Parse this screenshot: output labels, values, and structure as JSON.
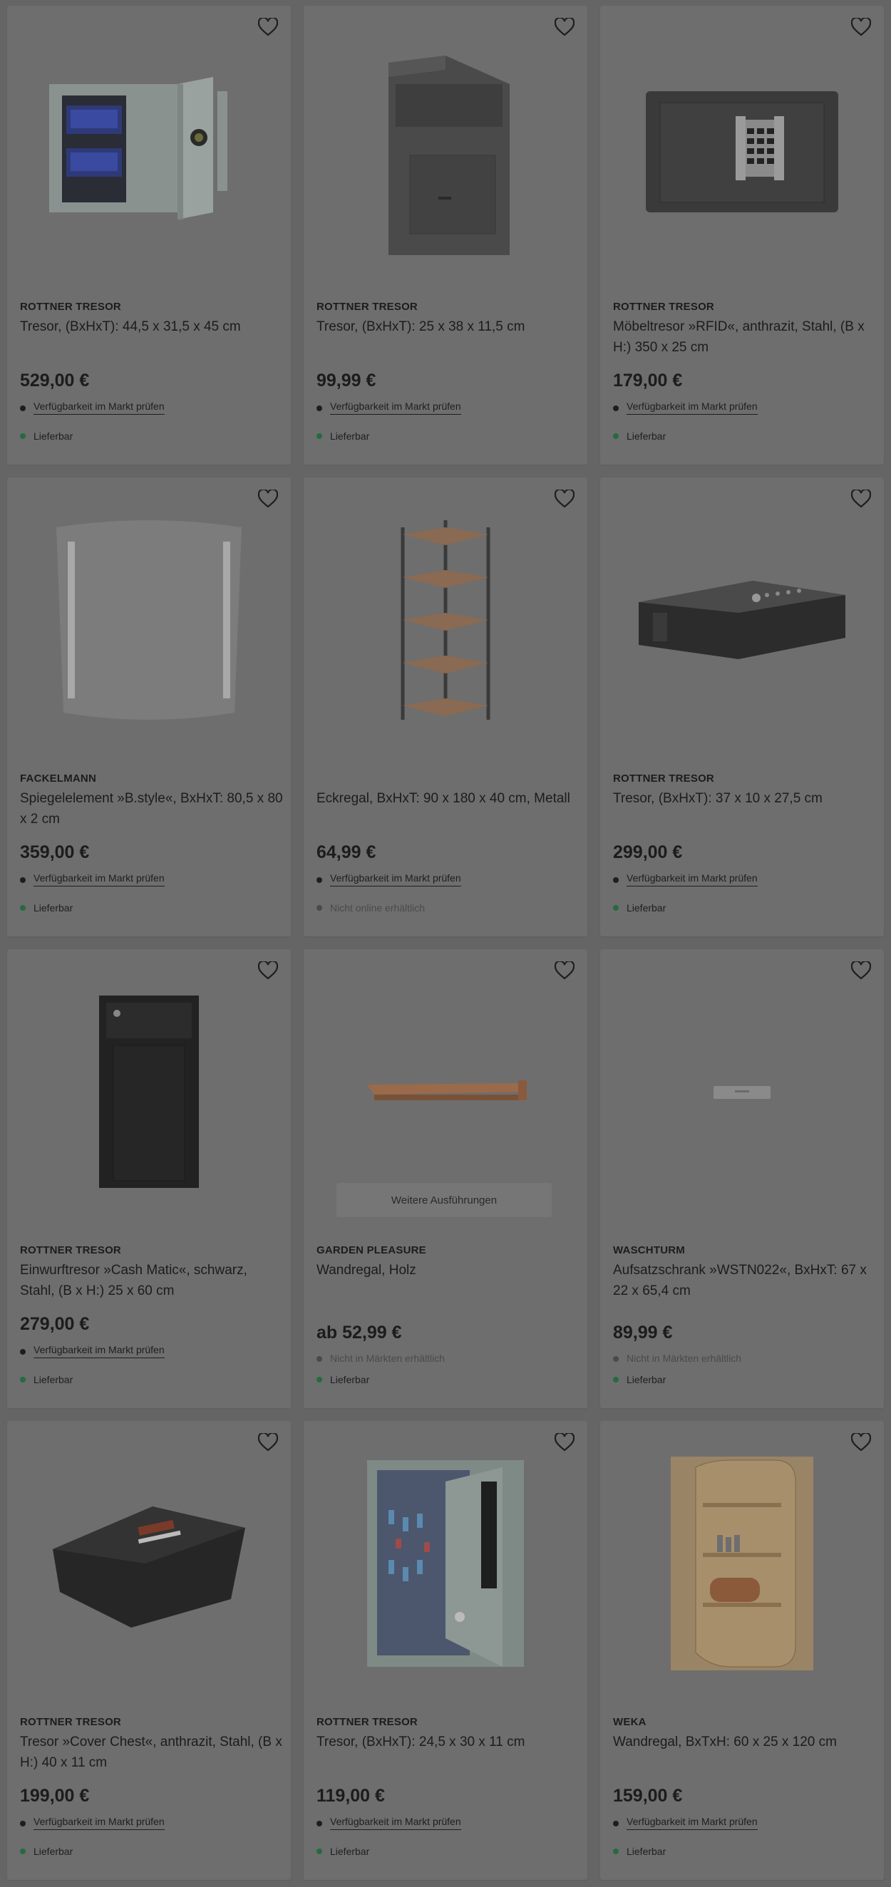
{
  "products": [
    {
      "brand": "ROTTNER TRESOR",
      "title": "Tresor, (BxHxT): 44,5 x 31,5 x 45 cm",
      "price": "529,00 €",
      "market": "Verfügbarkeit im Markt prüfen",
      "delivery": "Lieferbar",
      "image": "safe-open-icon"
    },
    {
      "brand": "ROTTNER TRESOR",
      "title": "Tresor, (BxHxT): 25 x 38 x 11,5 cm",
      "price": "99,99 €",
      "market": "Verfügbarkeit im Markt prüfen",
      "delivery": "Lieferbar",
      "image": "deposit-box-icon"
    },
    {
      "brand": "ROTTNER TRESOR",
      "title": "Möbeltresor »RFID«, anthrazit, Stahl, (B x H:) 350 x 25 cm",
      "price": "179,00 €",
      "market": "Verfügbarkeit im Markt prüfen",
      "delivery": "Lieferbar",
      "image": "electronic-safe-icon"
    },
    {
      "brand": "FACKELMANN",
      "title": "Spiegelelement »B.style«, BxHxT: 80,5 x 80 x 2 cm",
      "price": "359,00 €",
      "market": "Verfügbarkeit im Markt prüfen",
      "delivery": "Lieferbar",
      "image": "mirror-icon"
    },
    {
      "brand": "",
      "title": "Eckregal, BxHxT: 90 x 180 x 40 cm, Metall",
      "price": "64,99 €",
      "market": "Verfügbarkeit im Markt prüfen",
      "delivery": "Nicht online erhältlich",
      "image": "corner-shelf-icon"
    },
    {
      "brand": "ROTTNER TRESOR",
      "title": "Tresor, (BxHxT): 37 x 10 x 27,5 cm",
      "price": "299,00 €",
      "market": "Verfügbarkeit im Markt prüfen",
      "delivery": "Lieferbar",
      "image": "flat-safe-icon"
    },
    {
      "brand": "ROTTNER TRESOR",
      "title": "Einwurftresor »Cash Matic«, schwarz, Stahl, (B x H:) 25 x 60 cm",
      "price": "279,00 €",
      "market": "Verfügbarkeit im Markt prüfen",
      "delivery": "Lieferbar",
      "image": "cash-safe-icon"
    },
    {
      "brand": "GARDEN PLEASURE",
      "title": "Wandregal, Holz",
      "price": "ab 52,99 €",
      "market": "Nicht in Märkten erhältlich",
      "delivery": "Lieferbar",
      "image": "wall-shelf-icon",
      "variants": "Weitere Ausführungen"
    },
    {
      "brand": "WASCHTURM",
      "title": "Aufsatzschrank »WSTN022«, BxHxT: 67 x 22 x 65,4 cm",
      "price": "89,99 €",
      "market": "Nicht in Märkten erhältlich",
      "delivery": "Lieferbar",
      "image": "small-cabinet-icon"
    },
    {
      "brand": "ROTTNER TRESOR",
      "title": "Tresor »Cover Chest«, anthrazit, Stahl, (B x H:) 40 x 11 cm",
      "price": "199,00 €",
      "market": "Verfügbarkeit im Markt prüfen",
      "delivery": "Lieferbar",
      "image": "cover-chest-icon"
    },
    {
      "brand": "ROTTNER TRESOR",
      "title": "Tresor, (BxHxT): 24,5 x 30 x 11 cm",
      "price": "119,00 €",
      "market": "Verfügbarkeit im Markt prüfen",
      "delivery": "Lieferbar",
      "image": "key-safe-icon"
    },
    {
      "brand": "WEKA",
      "title": "Wandregal, BxTxH: 60 x 25 x 120 cm",
      "price": "159,00 €",
      "market": "Verfügbarkeit im Markt prüfen",
      "delivery": "Lieferbar",
      "image": "wood-shelf-icon"
    }
  ],
  "colors": {
    "overlay": "#656565",
    "card": "#6e6e6e",
    "available": "#246b40",
    "unavailable": "#4a4a4a"
  }
}
